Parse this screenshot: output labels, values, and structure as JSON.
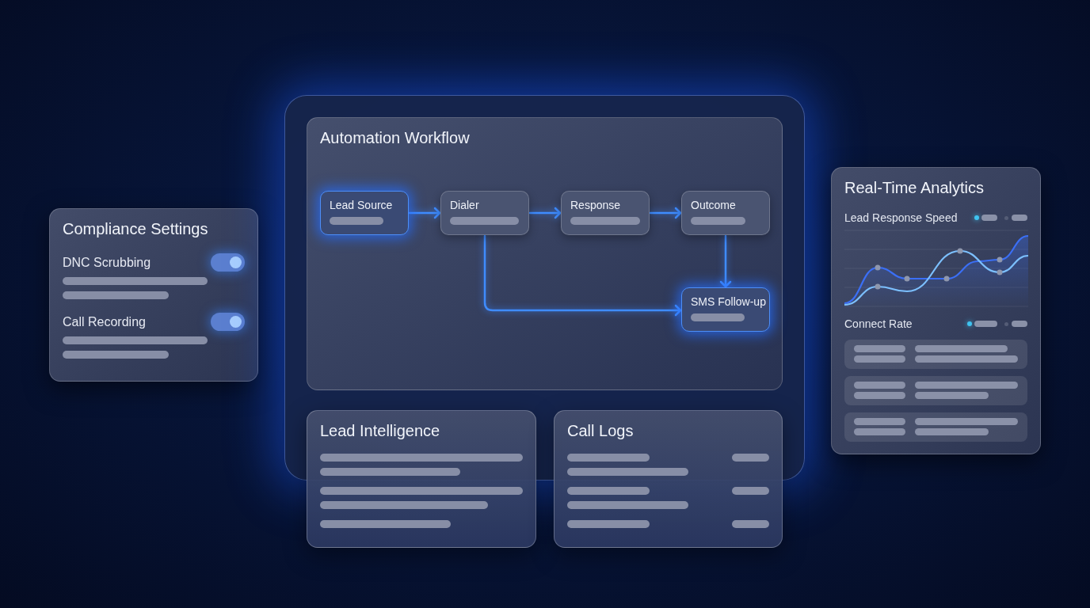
{
  "compliance_settings": {
    "title": "Compliance Settings",
    "settings": [
      {
        "label": "DNC Scrubbing",
        "on": true
      },
      {
        "label": "Call Recording",
        "on": true
      }
    ]
  },
  "automation_workflow": {
    "title": "Automation Workflow",
    "nodes": [
      {
        "label": "Lead Source",
        "highlighted": true
      },
      {
        "label": "Dialer",
        "highlighted": false
      },
      {
        "label": "Response",
        "highlighted": false
      },
      {
        "label": "Outcome",
        "highlighted": false
      },
      {
        "label": "SMS Follow-up",
        "highlighted": true
      }
    ]
  },
  "lead_intelligence": {
    "title": "Lead Intelligence"
  },
  "call_logs": {
    "title": "Call Logs"
  },
  "real_time_analytics": {
    "title": "Real-Time Analytics",
    "sections": [
      {
        "kind": "chart",
        "label": "Lead Response Speed"
      },
      {
        "kind": "list",
        "label": "Connect Rate"
      }
    ]
  }
}
